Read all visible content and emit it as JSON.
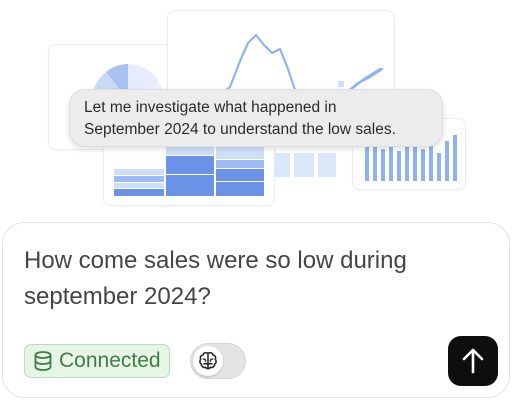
{
  "colors": {
    "chart_blue_dark": "#6a93e8",
    "chart_blue_mid": "#9dbcf3",
    "chart_blue_light": "#cfdefa",
    "connected_green": "#3f7d46",
    "send_button": "#0e0e0e"
  },
  "background_charts": {
    "pie_icon": "pie-chart-icon",
    "line_icon": "line-chart-icon",
    "stack_icon": "stacked-bar-chart-icon",
    "bars_icon": "bar-chart-icon"
  },
  "assistant_message": {
    "line1": "Let me investigate what happened in",
    "line2": "September 2024 to understand the low sales."
  },
  "composer": {
    "line1": "How come sales were so low during",
    "line2": "september 2024?",
    "connection_icon": "database-icon",
    "connection_label": "Connected",
    "toggle_icon": "brain-icon",
    "send_icon": "arrow-up-icon"
  }
}
